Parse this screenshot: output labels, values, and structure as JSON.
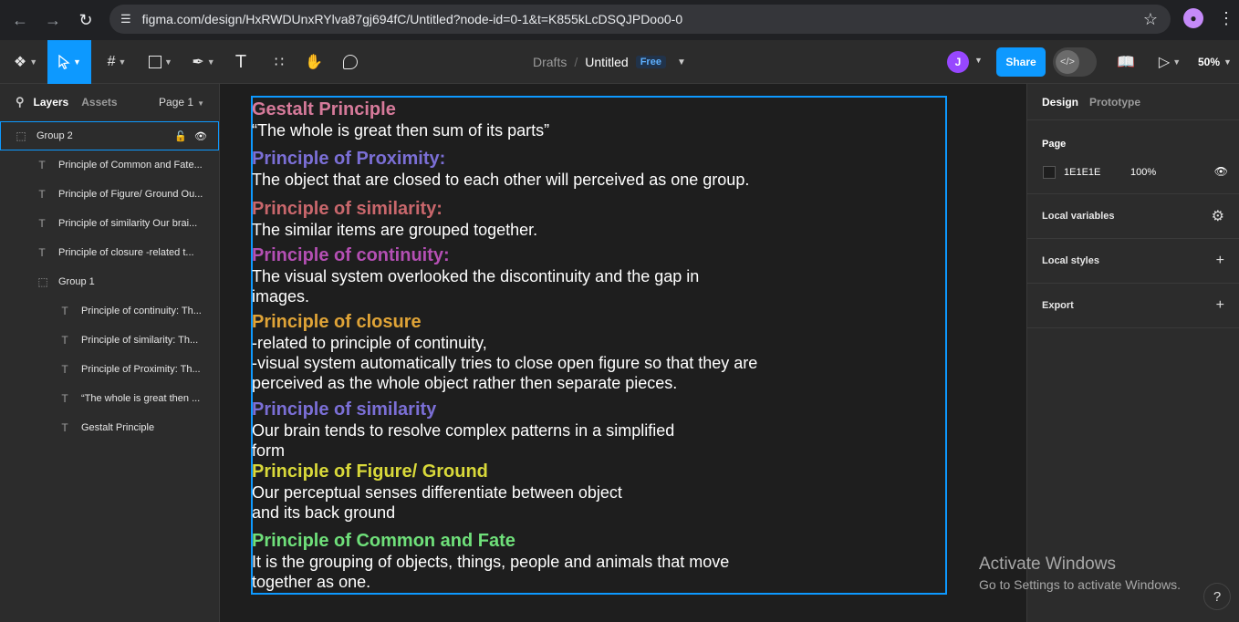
{
  "browser": {
    "url": "figma.com/design/HxRWDUnxRYlva87gj694fC/Untitled?node-id=0-1&t=K855kLcDSQJPDoo0-0"
  },
  "toolbar": {
    "breadcrumb_drafts": "Drafts",
    "breadcrumb_slash": "/",
    "file_title": "Untitled",
    "plan_badge": "Free",
    "avatar_initial": "J",
    "share_label": "Share",
    "zoom_level": "50%"
  },
  "left_panel": {
    "tab_layers": "Layers",
    "tab_assets": "Assets",
    "page_selector": "Page 1",
    "layers": [
      {
        "name": "Group 2",
        "type": "group"
      },
      {
        "name": "Principle of Common and Fate...",
        "type": "text"
      },
      {
        "name": "Principle of Figure/ Ground Ou...",
        "type": "text"
      },
      {
        "name": "Principle of similarity Our brai...",
        "type": "text"
      },
      {
        "name": "Principle of closure -related t...",
        "type": "text"
      },
      {
        "name": "Group 1",
        "type": "group"
      },
      {
        "name": "Principle of continuity: Th...",
        "type": "text"
      },
      {
        "name": "Principle of similarity: Th...",
        "type": "text"
      },
      {
        "name": "Principle of Proximity: Th...",
        "type": "text"
      },
      {
        "name": "“The whole is great then ...",
        "type": "text"
      },
      {
        "name": "Gestalt Principle",
        "type": "text"
      }
    ]
  },
  "canvas": {
    "blocks": [
      {
        "heading": "Gestalt Principle",
        "color": "#d67a9a",
        "lines": [
          "“The whole is great then sum of its parts”"
        ]
      },
      {
        "heading": "Principle of Proximity:",
        "color": "#7b6fd6",
        "lines": [
          "The object that are closed to each other will perceived as one group."
        ]
      },
      {
        "heading": "Principle of similarity:",
        "color": "#c9676c",
        "lines": [
          "The similar items are grouped together."
        ]
      },
      {
        "heading": "Principle of continuity:",
        "color": "#b44fb3",
        "lines": [
          "The visual system overlooked the discontinuity and the gap in",
          "images."
        ]
      },
      {
        "heading": "Principle of closure",
        "color": "#e0a437",
        "lines": [
          "-related to principle of continuity,",
          "-visual system automatically tries to close open figure so that they are",
          "perceived as the whole object rather then separate pieces."
        ]
      },
      {
        "heading": "Principle of similarity",
        "color": "#7b6fd6",
        "lines": [
          "Our brain tends to resolve complex patterns in a simplified",
          "form"
        ]
      },
      {
        "heading": "Principle of Figure/ Ground",
        "color": "#d9d93a",
        "lines": [
          "Our perceptual senses differentiate between object",
          "and its back ground"
        ]
      },
      {
        "heading": "Principle of Common and Fate",
        "color": "#6fe07a",
        "lines": [
          "It is the grouping of objects, things, people and animals that move",
          "together as one."
        ]
      }
    ]
  },
  "right_panel": {
    "tab_design": "Design",
    "tab_prototype": "Prototype",
    "page_title": "Page",
    "page_color_hex": "1E1E1E",
    "page_opacity": "100%",
    "local_variables": "Local variables",
    "local_styles": "Local styles",
    "export": "Export"
  },
  "watermark": {
    "line1": "Activate Windows",
    "line2": "Go to Settings to activate Windows."
  },
  "help": "?"
}
